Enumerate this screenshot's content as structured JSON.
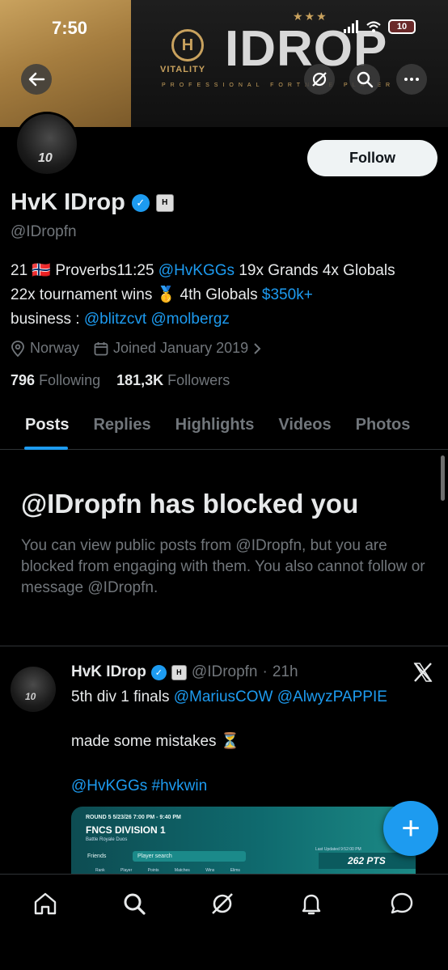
{
  "status_bar": {
    "time": "7:50",
    "battery": "10"
  },
  "banner": {
    "title": "IDROP",
    "brand": "VITALITY",
    "subtitle": "PROFESSIONAL FORTNITE PLAYER",
    "stars": "★★★"
  },
  "profile": {
    "display_name": "HvK IDrop",
    "handle": "@IDropfn",
    "follow_label": "Follow",
    "bio": {
      "line1_prefix": "21 🇳🇴 Proverbs11:25 ",
      "line1_link": "@HvKGGs",
      "line1_suffix": " 19x Grands 4x Globals",
      "line2_prefix": "22x tournament wins 🥇 4th Globals ",
      "line2_link": "$350k+",
      "line3_prefix": "business : ",
      "line3_link1": "@blitzcvt",
      "line3_link2": "@molbergz"
    },
    "location": "Norway",
    "joined": "Joined January 2019",
    "following_count": "796",
    "following_label": "Following",
    "followers_count": "181,3K",
    "followers_label": "Followers"
  },
  "tabs": [
    "Posts",
    "Replies",
    "Highlights",
    "Videos",
    "Photos"
  ],
  "blocked": {
    "title": "@IDropfn has blocked you",
    "body": "You can view public posts from @IDropfn, but you are blocked from engaging with them. You also cannot follow or message @IDropfn."
  },
  "post": {
    "name": "HvK IDrop",
    "handle": "@IDropfn",
    "time": "21h",
    "line1_prefix": "5th div 1 finals ",
    "line1_link1": "@MariusCOW",
    "line1_link2": "@AlwyzPAPPIE",
    "line2": "made some mistakes ⏳",
    "line3_link1": "@HvKGGs",
    "line3_link2": "#hvkwin",
    "media": {
      "round": "ROUND 5   5/23/26 7:00 PM - 9:40 PM",
      "title": "FNCS DIVISION 1",
      "sub": "Battle Royale  Duos",
      "friends": "Friends",
      "search_placeholder": "Player search",
      "updated": "Last Updated 9:52:00 PM",
      "points": "262 PTS",
      "cols": "Rank Player Points Matches Wins Elims"
    }
  },
  "fab_label": "+",
  "icons": {
    "back": "back-arrow-icon",
    "grok": "grok-icon",
    "search": "search-icon",
    "more": "more-icon",
    "location": "location-pin-icon",
    "calendar": "calendar-icon",
    "x_logo": "x-logo-icon"
  },
  "colors": {
    "accent": "#1d9bf0",
    "text": "#e7e9ea",
    "muted": "#71767b",
    "background": "#000000",
    "gold": "#c9a25e"
  }
}
